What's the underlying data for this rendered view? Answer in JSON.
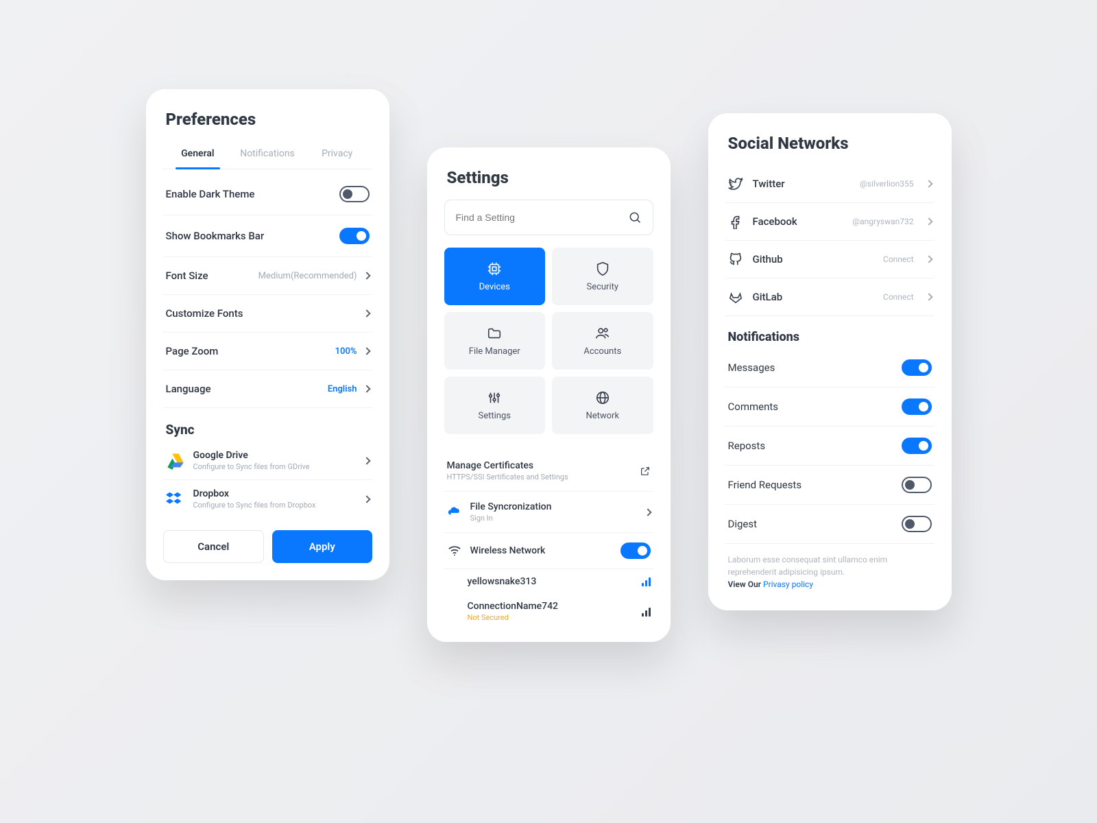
{
  "prefs": {
    "title": "Preferences",
    "tabs": {
      "general": "General",
      "notifications": "Notifications",
      "privacy": "Privacy"
    },
    "rows": {
      "dark": "Enable Dark Theme",
      "bmbar": "Show Bookmarks Bar",
      "font": "Font Size",
      "fontVal": "Medium(Recommended)",
      "custom": "Customize Fonts",
      "zoom": "Page Zoom",
      "zoomVal": "100%",
      "lang": "Language",
      "langVal": "English"
    },
    "syncHdr": "Sync",
    "gdrive": {
      "title": "Google Drive",
      "sub": "Configure to Sync files from GDrive"
    },
    "dropbox": {
      "title": "Dropbox",
      "sub": "Configure to Sync files from Dropbox"
    },
    "btnCancel": "Cancel",
    "btnApply": "Apply"
  },
  "settings": {
    "title": "Settings",
    "searchPlaceholder": "Find a Setting",
    "tiles": {
      "devices": "Devices",
      "security": "Security",
      "files": "File Manager",
      "accounts": "Accounts",
      "settings": "Settings",
      "network": "Network"
    },
    "cert": {
      "title": "Manage Certificates",
      "sub": "HTTPS/SSI Sertificates and Settings"
    },
    "sync": {
      "title": "File Syncronization",
      "sub": "Sign In"
    },
    "wifi": "Wireless Network",
    "net1": {
      "name": "yellowsnake313"
    },
    "net2": {
      "name": "ConnectionName742",
      "sub": "Not Secured"
    }
  },
  "social": {
    "title": "Social Networks",
    "rows": {
      "twitter": {
        "name": "Twitter",
        "val": "@silverlion355"
      },
      "facebook": {
        "name": "Facebook",
        "val": "@angryswan732"
      },
      "github": {
        "name": "Github",
        "val": "Connect"
      },
      "gitlab": {
        "name": "GitLab",
        "val": "Connect"
      }
    },
    "notifHdr": "Notifications",
    "notif": {
      "messages": "Messages",
      "comments": "Comments",
      "reposts": "Reposts",
      "friend": "Friend Requests",
      "digest": "Digest"
    },
    "foot1": "Laborum esse consequat sint ullamco enim reprehenderit adipisicing ipsum.",
    "foot2": "View Our ",
    "footLink": "Privasy policy"
  }
}
